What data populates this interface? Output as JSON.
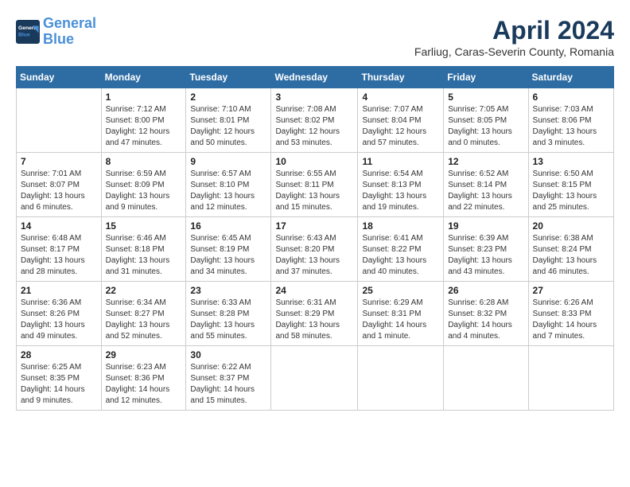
{
  "header": {
    "logo_line1": "General",
    "logo_line2": "Blue",
    "title": "April 2024",
    "subtitle": "Farliug, Caras-Severin County, Romania"
  },
  "weekdays": [
    "Sunday",
    "Monday",
    "Tuesday",
    "Wednesday",
    "Thursday",
    "Friday",
    "Saturday"
  ],
  "weeks": [
    [
      {
        "day": "",
        "content": ""
      },
      {
        "day": "1",
        "content": "Sunrise: 7:12 AM\nSunset: 8:00 PM\nDaylight: 12 hours\nand 47 minutes."
      },
      {
        "day": "2",
        "content": "Sunrise: 7:10 AM\nSunset: 8:01 PM\nDaylight: 12 hours\nand 50 minutes."
      },
      {
        "day": "3",
        "content": "Sunrise: 7:08 AM\nSunset: 8:02 PM\nDaylight: 12 hours\nand 53 minutes."
      },
      {
        "day": "4",
        "content": "Sunrise: 7:07 AM\nSunset: 8:04 PM\nDaylight: 12 hours\nand 57 minutes."
      },
      {
        "day": "5",
        "content": "Sunrise: 7:05 AM\nSunset: 8:05 PM\nDaylight: 13 hours\nand 0 minutes."
      },
      {
        "day": "6",
        "content": "Sunrise: 7:03 AM\nSunset: 8:06 PM\nDaylight: 13 hours\nand 3 minutes."
      }
    ],
    [
      {
        "day": "7",
        "content": "Sunrise: 7:01 AM\nSunset: 8:07 PM\nDaylight: 13 hours\nand 6 minutes."
      },
      {
        "day": "8",
        "content": "Sunrise: 6:59 AM\nSunset: 8:09 PM\nDaylight: 13 hours\nand 9 minutes."
      },
      {
        "day": "9",
        "content": "Sunrise: 6:57 AM\nSunset: 8:10 PM\nDaylight: 13 hours\nand 12 minutes."
      },
      {
        "day": "10",
        "content": "Sunrise: 6:55 AM\nSunset: 8:11 PM\nDaylight: 13 hours\nand 15 minutes."
      },
      {
        "day": "11",
        "content": "Sunrise: 6:54 AM\nSunset: 8:13 PM\nDaylight: 13 hours\nand 19 minutes."
      },
      {
        "day": "12",
        "content": "Sunrise: 6:52 AM\nSunset: 8:14 PM\nDaylight: 13 hours\nand 22 minutes."
      },
      {
        "day": "13",
        "content": "Sunrise: 6:50 AM\nSunset: 8:15 PM\nDaylight: 13 hours\nand 25 minutes."
      }
    ],
    [
      {
        "day": "14",
        "content": "Sunrise: 6:48 AM\nSunset: 8:17 PM\nDaylight: 13 hours\nand 28 minutes."
      },
      {
        "day": "15",
        "content": "Sunrise: 6:46 AM\nSunset: 8:18 PM\nDaylight: 13 hours\nand 31 minutes."
      },
      {
        "day": "16",
        "content": "Sunrise: 6:45 AM\nSunset: 8:19 PM\nDaylight: 13 hours\nand 34 minutes."
      },
      {
        "day": "17",
        "content": "Sunrise: 6:43 AM\nSunset: 8:20 PM\nDaylight: 13 hours\nand 37 minutes."
      },
      {
        "day": "18",
        "content": "Sunrise: 6:41 AM\nSunset: 8:22 PM\nDaylight: 13 hours\nand 40 minutes."
      },
      {
        "day": "19",
        "content": "Sunrise: 6:39 AM\nSunset: 8:23 PM\nDaylight: 13 hours\nand 43 minutes."
      },
      {
        "day": "20",
        "content": "Sunrise: 6:38 AM\nSunset: 8:24 PM\nDaylight: 13 hours\nand 46 minutes."
      }
    ],
    [
      {
        "day": "21",
        "content": "Sunrise: 6:36 AM\nSunset: 8:26 PM\nDaylight: 13 hours\nand 49 minutes."
      },
      {
        "day": "22",
        "content": "Sunrise: 6:34 AM\nSunset: 8:27 PM\nDaylight: 13 hours\nand 52 minutes."
      },
      {
        "day": "23",
        "content": "Sunrise: 6:33 AM\nSunset: 8:28 PM\nDaylight: 13 hours\nand 55 minutes."
      },
      {
        "day": "24",
        "content": "Sunrise: 6:31 AM\nSunset: 8:29 PM\nDaylight: 13 hours\nand 58 minutes."
      },
      {
        "day": "25",
        "content": "Sunrise: 6:29 AM\nSunset: 8:31 PM\nDaylight: 14 hours\nand 1 minute."
      },
      {
        "day": "26",
        "content": "Sunrise: 6:28 AM\nSunset: 8:32 PM\nDaylight: 14 hours\nand 4 minutes."
      },
      {
        "day": "27",
        "content": "Sunrise: 6:26 AM\nSunset: 8:33 PM\nDaylight: 14 hours\nand 7 minutes."
      }
    ],
    [
      {
        "day": "28",
        "content": "Sunrise: 6:25 AM\nSunset: 8:35 PM\nDaylight: 14 hours\nand 9 minutes."
      },
      {
        "day": "29",
        "content": "Sunrise: 6:23 AM\nSunset: 8:36 PM\nDaylight: 14 hours\nand 12 minutes."
      },
      {
        "day": "30",
        "content": "Sunrise: 6:22 AM\nSunset: 8:37 PM\nDaylight: 14 hours\nand 15 minutes."
      },
      {
        "day": "",
        "content": ""
      },
      {
        "day": "",
        "content": ""
      },
      {
        "day": "",
        "content": ""
      },
      {
        "day": "",
        "content": ""
      }
    ]
  ]
}
